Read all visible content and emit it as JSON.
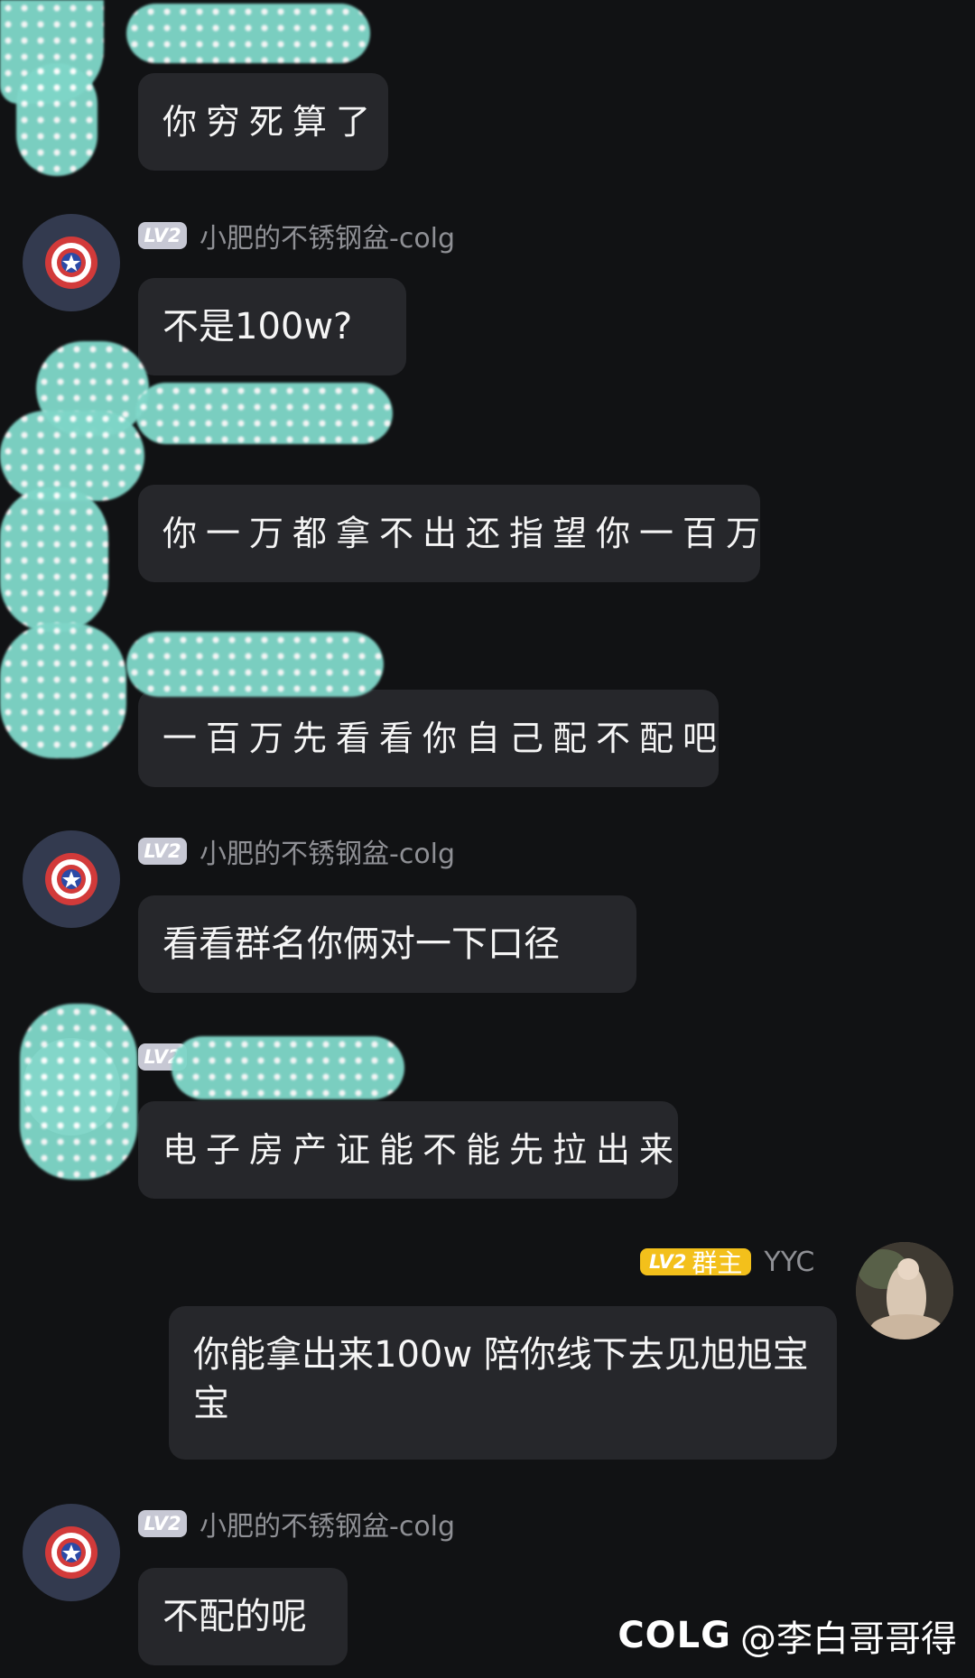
{
  "messages": [
    {
      "id": "m1",
      "sender": "",
      "text": "你穷死算了"
    },
    {
      "id": "m2",
      "sender": "小肥的不锈钢盆-colg",
      "level": "LV2",
      "text": "不是100w?"
    },
    {
      "id": "m3",
      "text": "你一万都拿不出还指望你一百万"
    },
    {
      "id": "m4",
      "text": "一百万先看看你自己配不配吧"
    },
    {
      "id": "m5",
      "sender": "小肥的不锈钢盆-colg",
      "level": "LV2",
      "text": "看看群名你俩对一下口径"
    },
    {
      "id": "m6",
      "level": "LV2",
      "text": "电子房产证能不能先拉出来"
    },
    {
      "id": "m7",
      "sender": "YYC",
      "level": "LV2",
      "role": "群主",
      "text": "你能拿出来100w 陪你线下去见旭旭宝宝"
    },
    {
      "id": "m8",
      "sender": "小肥的不锈钢盆-colg",
      "level": "LV2",
      "text": "不配的呢"
    }
  ],
  "watermark": {
    "logo": "COLG",
    "handle": "@李白哥哥得"
  },
  "colors": {
    "background": "#111214",
    "bubble": "#26272b",
    "name": "#8f9095",
    "owner_badge": "#f3c01b",
    "level_badge": "#c7c8d4",
    "mask": "#7fd6c8"
  },
  "icons": {
    "captain_avatar": "captain-shield-icon",
    "yyc_avatar": "photo-avatar"
  }
}
